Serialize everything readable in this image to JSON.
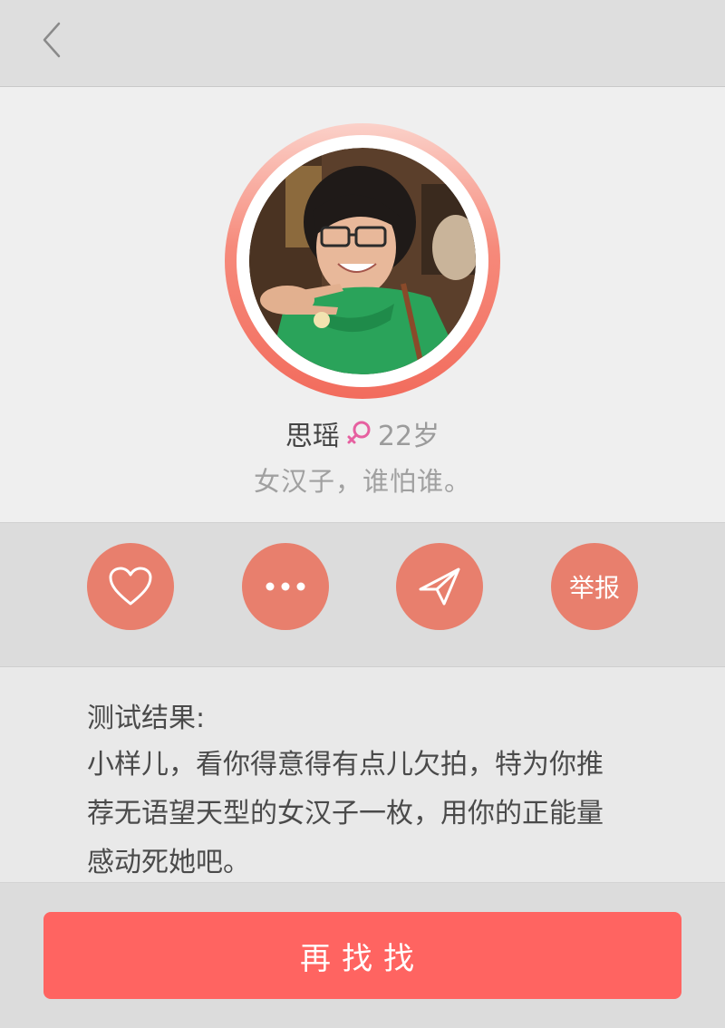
{
  "header": {
    "back_icon": "chevron-left-icon"
  },
  "profile": {
    "name": "思瑶",
    "gender_icon": "female-symbol-icon",
    "age": "22岁",
    "motto": "女汉子，谁怕谁。"
  },
  "actions": {
    "like_icon": "heart-icon",
    "more_icon": "more-dots-icon",
    "share_icon": "send-icon",
    "report_label": "举报"
  },
  "result": {
    "title": "测试结果:",
    "lines": [
      "小样儿，看你得意得有点儿欠拍，特为你推",
      "荐无语望天型的女汉子一枚，用你的正能量",
      "感动死她吧。"
    ]
  },
  "bottom": {
    "retry_label": "再找找"
  },
  "colors": {
    "accent": "#ff6461",
    "action_button": "#e87f6d",
    "female_icon": "#e660a0"
  }
}
